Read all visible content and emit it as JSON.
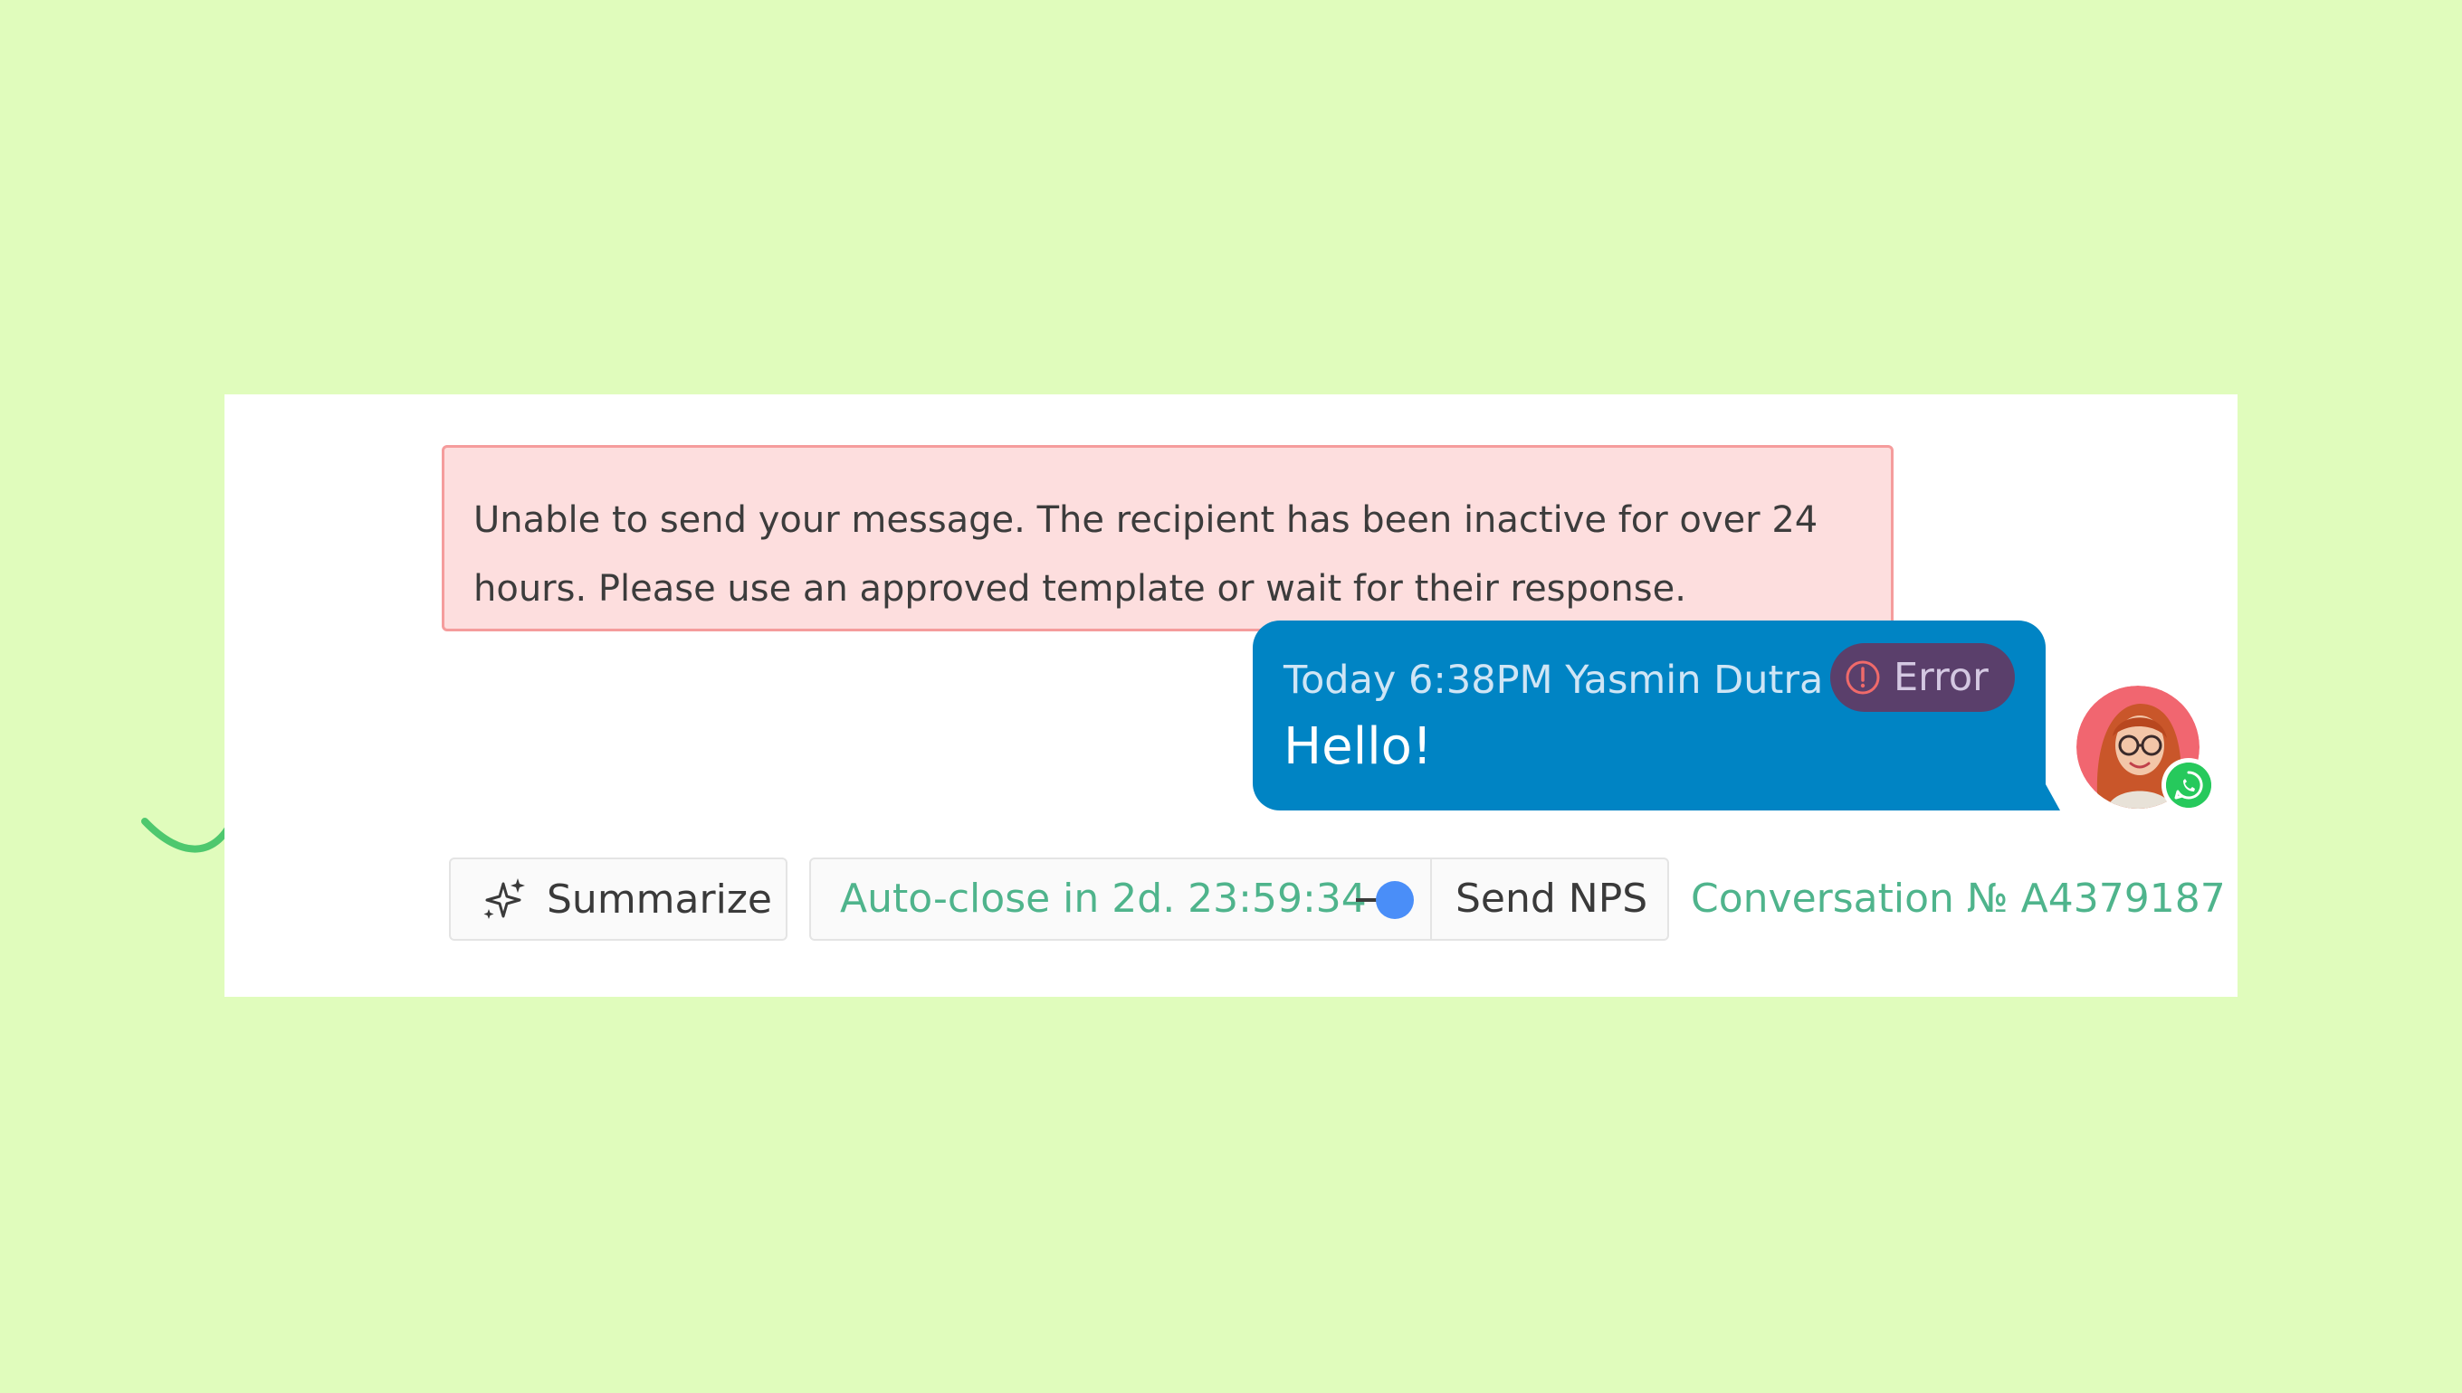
{
  "error_tooltip": {
    "line1": "Unable to send your message. The recipient has been inactive for over 24",
    "line2": "hours. Please use an approved template or wait for their response."
  },
  "message": {
    "meta": "Today 6:38PM Yasmin Dutra",
    "text": "Hello!",
    "status_label": "Error",
    "status_icon": "exclamation-circle-icon",
    "bubble_color": "#0084c4"
  },
  "avatar": {
    "channel_icon": "whatsapp-icon",
    "channel_color": "#26c95c"
  },
  "toolbar": {
    "summarize_label": "Summarize",
    "summarize_icon": "sparkles-icon",
    "auto_close_label": "Auto-close in 2d. 23:59:34",
    "auto_close_enabled": true,
    "send_nps_label": "Send NPS",
    "conversation_label": "Conversation № A4379187"
  },
  "colors": {
    "background": "#e0fcbc",
    "accent_green": "#4fb48c",
    "error_bg": "#fddede",
    "error_border": "#f59c9c",
    "toggle_blue": "#4a8ef8"
  }
}
